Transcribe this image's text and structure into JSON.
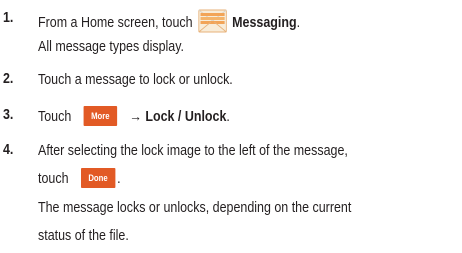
{
  "steps": [
    {
      "number": "1.",
      "line1_before": "From a Home screen, touch",
      "icon": "messaging-envelope-icon",
      "line1_bold": "Messaging",
      "line1_after": ".",
      "line2": "All message types display."
    },
    {
      "number": "2.",
      "line1": "Touch a message to lock or unlock."
    },
    {
      "number": "3.",
      "line1_before": "Touch",
      "button_label": "More",
      "arrow_bold": "→ Lock / Unlock",
      "line1_after": "."
    },
    {
      "number": "4.",
      "line1": "After selecting the lock image to the left of the message,",
      "line2_before": "touch",
      "button_label": "Done",
      "line2_after": ".",
      "line3": "The message locks or unlocks, depending on the current",
      "line4": "status of the file."
    }
  ],
  "colors": {
    "button_bg": "#e25a25",
    "envelope_orange": "#f0a45a",
    "envelope_light": "#f8ecd8",
    "text": "#231f20"
  }
}
